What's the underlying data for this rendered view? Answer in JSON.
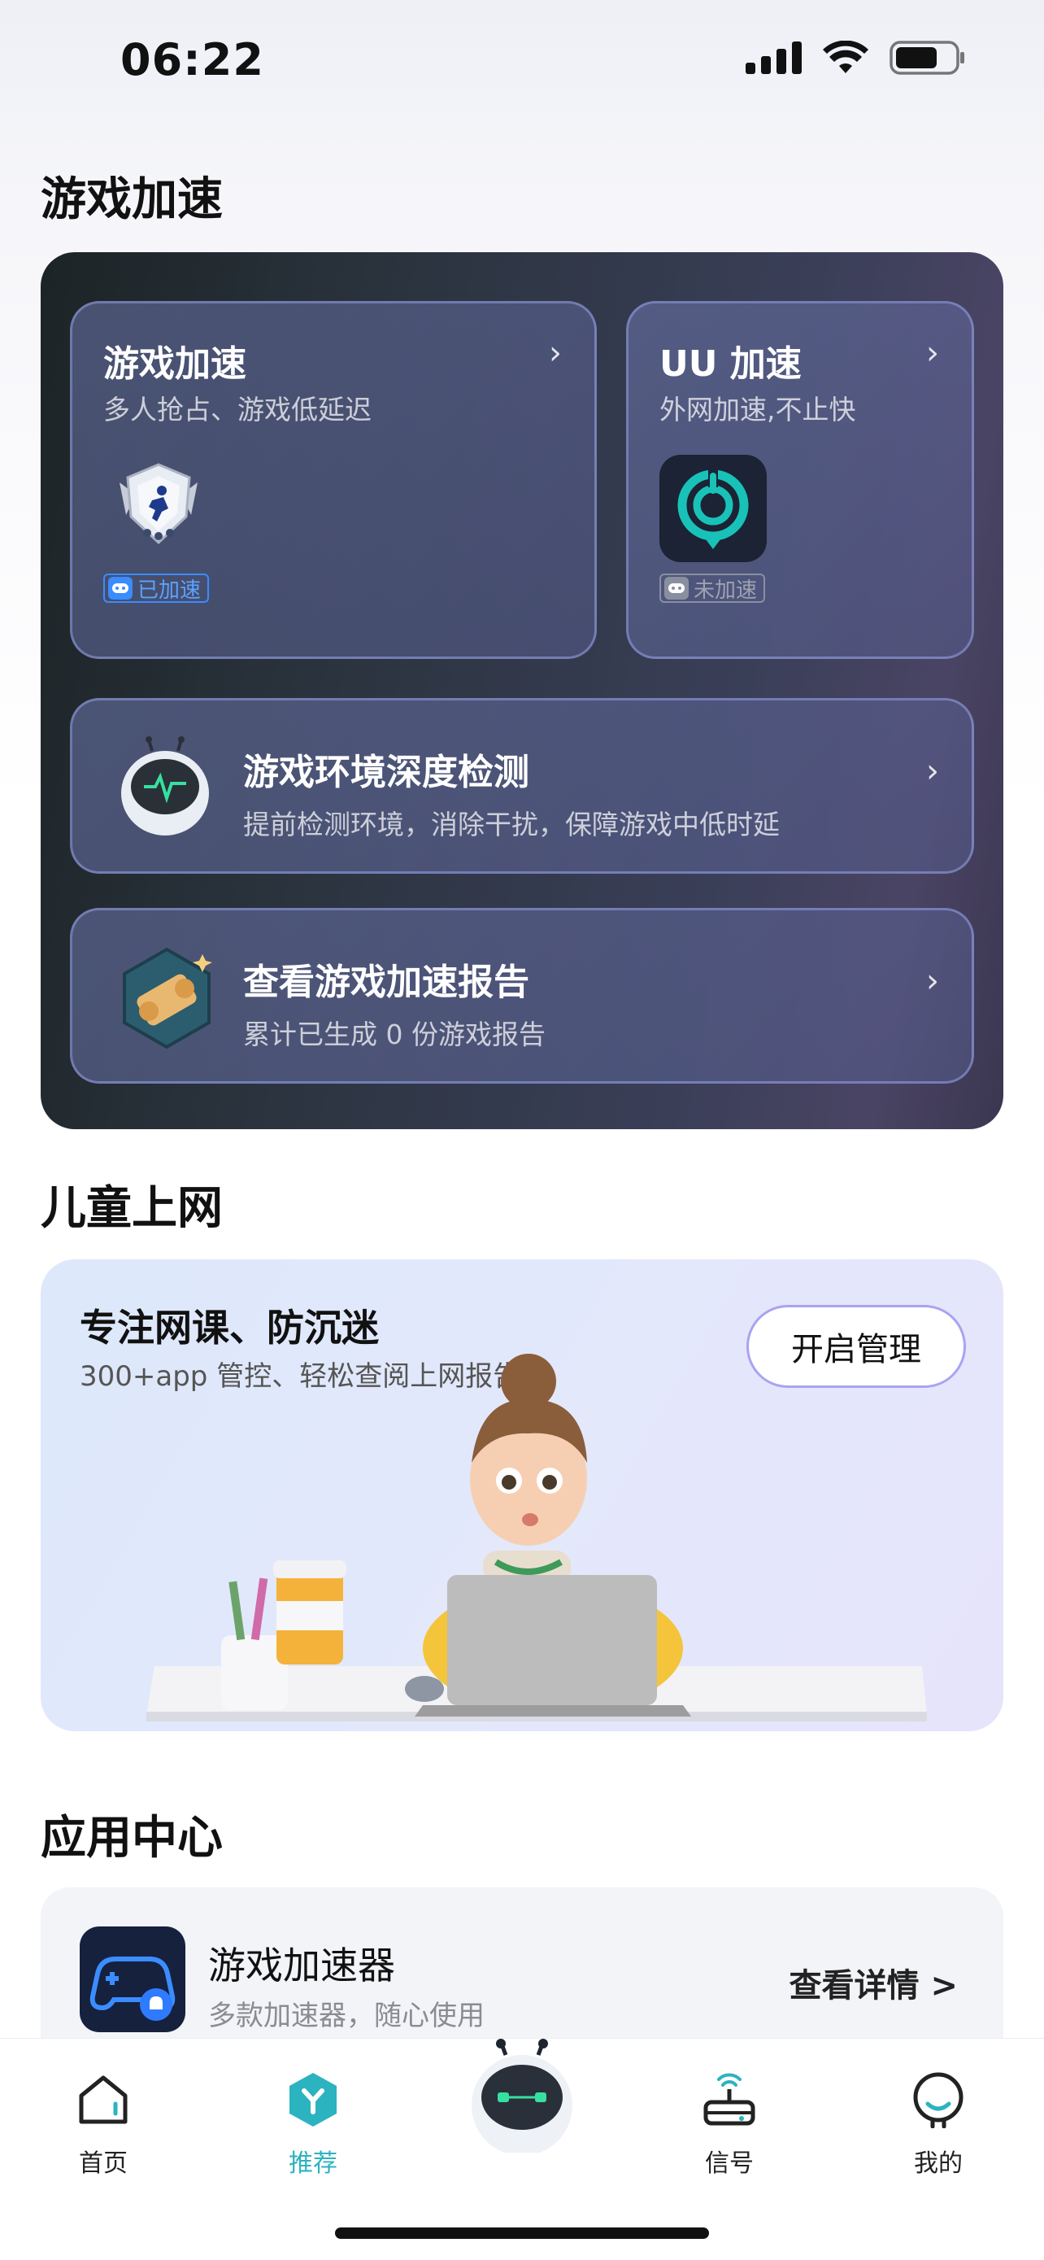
{
  "status_bar": {
    "time": "06:22"
  },
  "game_section": {
    "title": "游戏加速",
    "tile_game": {
      "title": "游戏加速",
      "subtitle": "多人抢占、游戏低延迟",
      "badge": "已加速"
    },
    "tile_uu": {
      "title": "UU 加速",
      "subtitle": "外网加速,不止快",
      "badge": "未加速"
    },
    "detect": {
      "title": "游戏环境深度检测",
      "subtitle": "提前检测环境，消除干扰，保障游戏中低时延"
    },
    "report": {
      "title": "查看游戏加速报告",
      "subtitle": "累计已生成 0 份游戏报告"
    }
  },
  "kids_section": {
    "title": "儿童上网",
    "card_title": "专注网课、防沉迷",
    "card_subtitle": "300+app 管控、轻松查阅上网报告",
    "button": "开启管理"
  },
  "app_center": {
    "title": "应用中心",
    "app_name": "游戏加速器",
    "app_desc": "多款加速器，随心使用",
    "detail": "查看详情 >"
  },
  "tabbar": {
    "tabs": [
      {
        "label": "首页",
        "icon": "home-icon"
      },
      {
        "label": "推荐",
        "icon": "recommend-icon",
        "active": true
      },
      {
        "label": "",
        "icon": "robot-assistant-icon"
      },
      {
        "label": "信号",
        "icon": "router-signal-icon"
      },
      {
        "label": "我的",
        "icon": "profile-icon"
      }
    ]
  },
  "colors": {
    "accent": "#2bb3c0",
    "badge_on": "#3a8cff",
    "panel_dark": "#2c3440"
  }
}
